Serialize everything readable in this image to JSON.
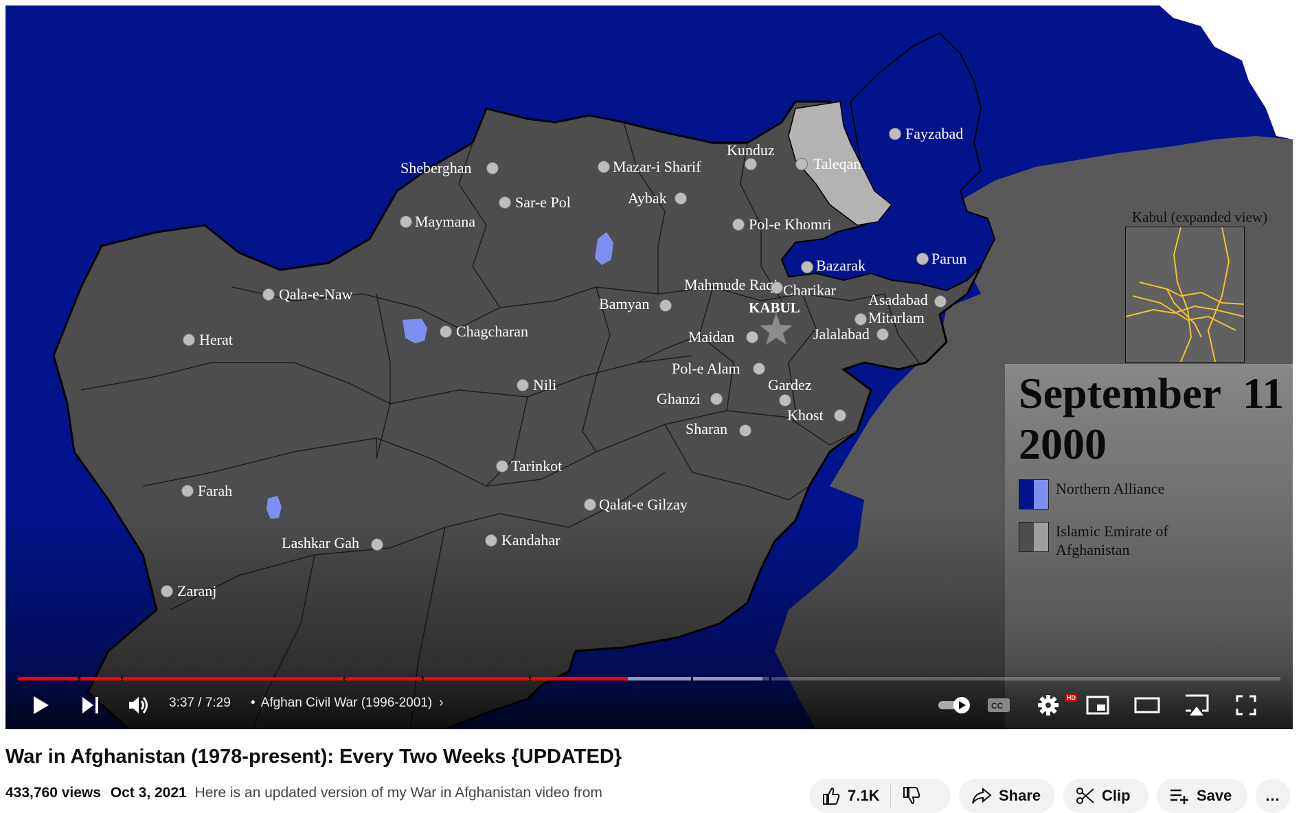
{
  "map": {
    "inset_title": "Kabul (expanded view)",
    "capital_label": "KABUL",
    "date_line1": "September  11",
    "date_line2": "2000",
    "colors": {
      "northern_alliance_dark": "#02148c",
      "northern_alliance_light": "#7d8ff0",
      "emirate_dark": "#4d4d4d",
      "emirate_light": "#9e9e9e",
      "contested": "#b3b3b3",
      "roads": "#f2c12e"
    },
    "legend": [
      {
        "label": "Northern Alliance",
        "dark": "#02148c",
        "light": "#7d8ff0"
      },
      {
        "label": "Islamic Emirate of Afghanistan",
        "dark": "#4d4d4d",
        "light": "#9e9e9e"
      }
    ],
    "cities": [
      "Sheberghan",
      "Mazar-i Sharif",
      "Kunduz",
      "Taleqan",
      "Fayzabad",
      "Aybak",
      "Sar-e Pol",
      "Maymana",
      "Pol-e Khomri",
      "Bazarak",
      "Parun",
      "Mahmude Raqi",
      "Charikar",
      "Asadabad",
      "Mitarlam",
      "Qala-e-Naw",
      "Bamyan",
      "Jalalabad",
      "Herat",
      "Chagcharan",
      "Maidan",
      "Pol-e Alam",
      "Gardez",
      "Nili",
      "Ghanzi",
      "Khost",
      "Sharan",
      "Tarinkot",
      "Farah",
      "Qalat-e Gilzay",
      "Lashkar Gah",
      "Kandahar",
      "Zaranj"
    ]
  },
  "player": {
    "time": "3:37 / 7:29",
    "chapter": "Afghan Civil War (1996-2001)",
    "progress_played": 0.483,
    "progress_buffered": 0.59,
    "hd_badge": "HD",
    "buttons": {
      "play": "play-icon",
      "next": "next-icon",
      "volume": "volume-icon",
      "autoplay": "autoplay-toggle",
      "captions": "captions-icon",
      "settings": "gear-icon",
      "miniplayer": "miniplayer-icon",
      "theater": "theater-icon",
      "airplay": "airplay-icon",
      "fullscreen": "fullscreen-icon"
    }
  },
  "video": {
    "title": "War in Afghanistan (1978-present): Every Two Weeks {UPDATED}",
    "views": "433,760 views",
    "date": "Oct 3, 2021",
    "description": "Here is an updated version of my War in Afghanistan video from",
    "likes": "7.1K",
    "share_label": "Share",
    "clip_label": "Clip",
    "save_label": "Save",
    "more_label": "..."
  }
}
